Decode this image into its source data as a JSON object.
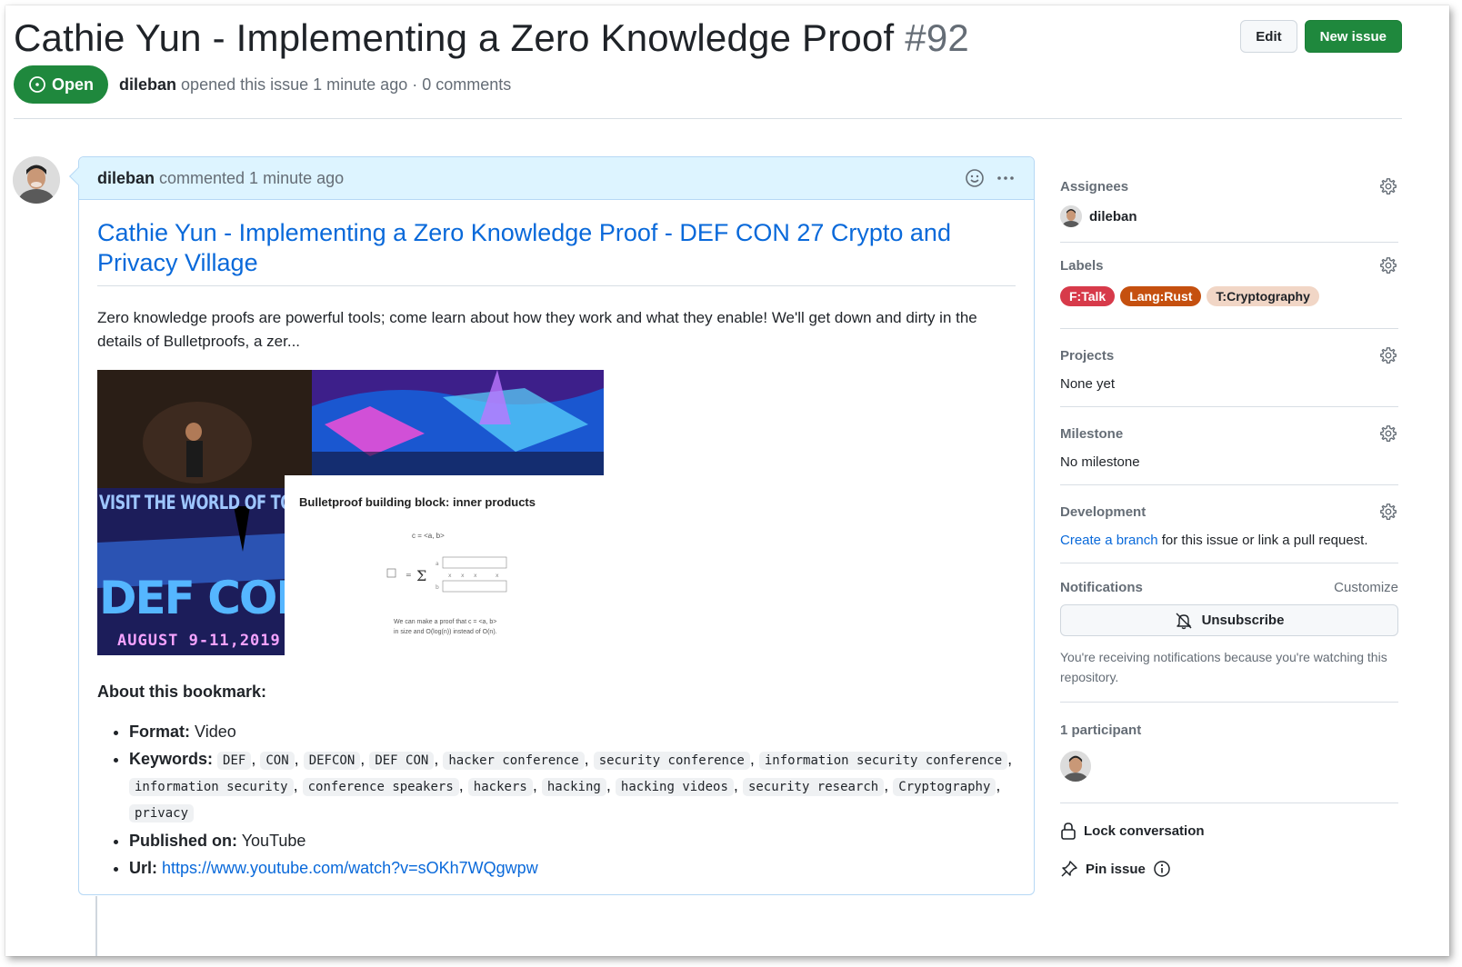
{
  "issue": {
    "title": "Cathie Yun - Implementing a Zero Knowledge Proof",
    "number": "#92",
    "state": "Open",
    "author": "dileban",
    "meta": "opened this issue 1 minute ago · 0 comments"
  },
  "header_actions": {
    "edit_label": "Edit",
    "new_issue_label": "New issue"
  },
  "comment": {
    "author": "dileban",
    "meta": "commented 1 minute ago",
    "link_title": "Cathie Yun - Implementing a Zero Knowledge Proof - DEF CON 27 Crypto and Privacy Village",
    "description": "Zero knowledge proofs are powerful tools; come learn about how they work and what they enable! We'll get down and dirty in the details of Bulletproofs, a zer...",
    "thumbnail": {
      "visit_text": "VISIT THE WORLD OF TOMORROW",
      "defcon_text": "DEF CON",
      "date_text": "AUGUST 9-11,2019",
      "slide_title": "Bulletproof building block: inner products",
      "slide_eq": "c = <a, b>",
      "slide_foot_1": "We can make a proof that c = <a, b>",
      "slide_foot_2": "in size and O(log(n)) instead of O(n)."
    },
    "about_heading": "About this bookmark:",
    "format_label": "Format:",
    "format_value": "Video",
    "keywords_label": "Keywords:",
    "keywords": [
      "DEF",
      "CON",
      "DEFCON",
      "DEF CON",
      "hacker conference",
      "security conference",
      "information security conference",
      "information security",
      "conference speakers",
      "hackers",
      "hacking",
      "hacking videos",
      "security research",
      "Cryptography",
      "privacy"
    ],
    "published_label": "Published on:",
    "published_value": "YouTube",
    "url_label": "Url:",
    "url_value": "https://www.youtube.com/watch?v=sOKh7WQgwpw"
  },
  "sidebar": {
    "assignees": {
      "heading": "Assignees",
      "name": "dileban"
    },
    "labels": {
      "heading": "Labels",
      "items": [
        {
          "name": "F:Talk",
          "bg": "#d73a4a",
          "fg": "#ffffff"
        },
        {
          "name": "Lang:Rust",
          "bg": "#c5500f",
          "fg": "#ffffff"
        },
        {
          "name": "T:Cryptography",
          "bg": "#f1d6c6",
          "fg": "#1f2328"
        }
      ]
    },
    "projects": {
      "heading": "Projects",
      "value": "None yet"
    },
    "milestone": {
      "heading": "Milestone",
      "value": "No milestone"
    },
    "development": {
      "heading": "Development",
      "link": "Create a branch",
      "rest": " for this issue or link a pull request."
    },
    "notifications": {
      "heading": "Notifications",
      "customize": "Customize",
      "button": "Unsubscribe",
      "note": "You're receiving notifications because you're watching this repository."
    },
    "participants": {
      "heading": "1 participant"
    },
    "lock_label": "Lock conversation",
    "pin_label": "Pin issue"
  },
  "colors": {
    "green": "#1f883d",
    "link": "#0969da",
    "comment_header": "#ddf4ff"
  },
  "icons": [
    "issue-open-icon",
    "smiley-icon",
    "kebab-icon",
    "gear-icon",
    "bell-slash-icon",
    "lock-icon",
    "pin-icon",
    "info-icon"
  ]
}
